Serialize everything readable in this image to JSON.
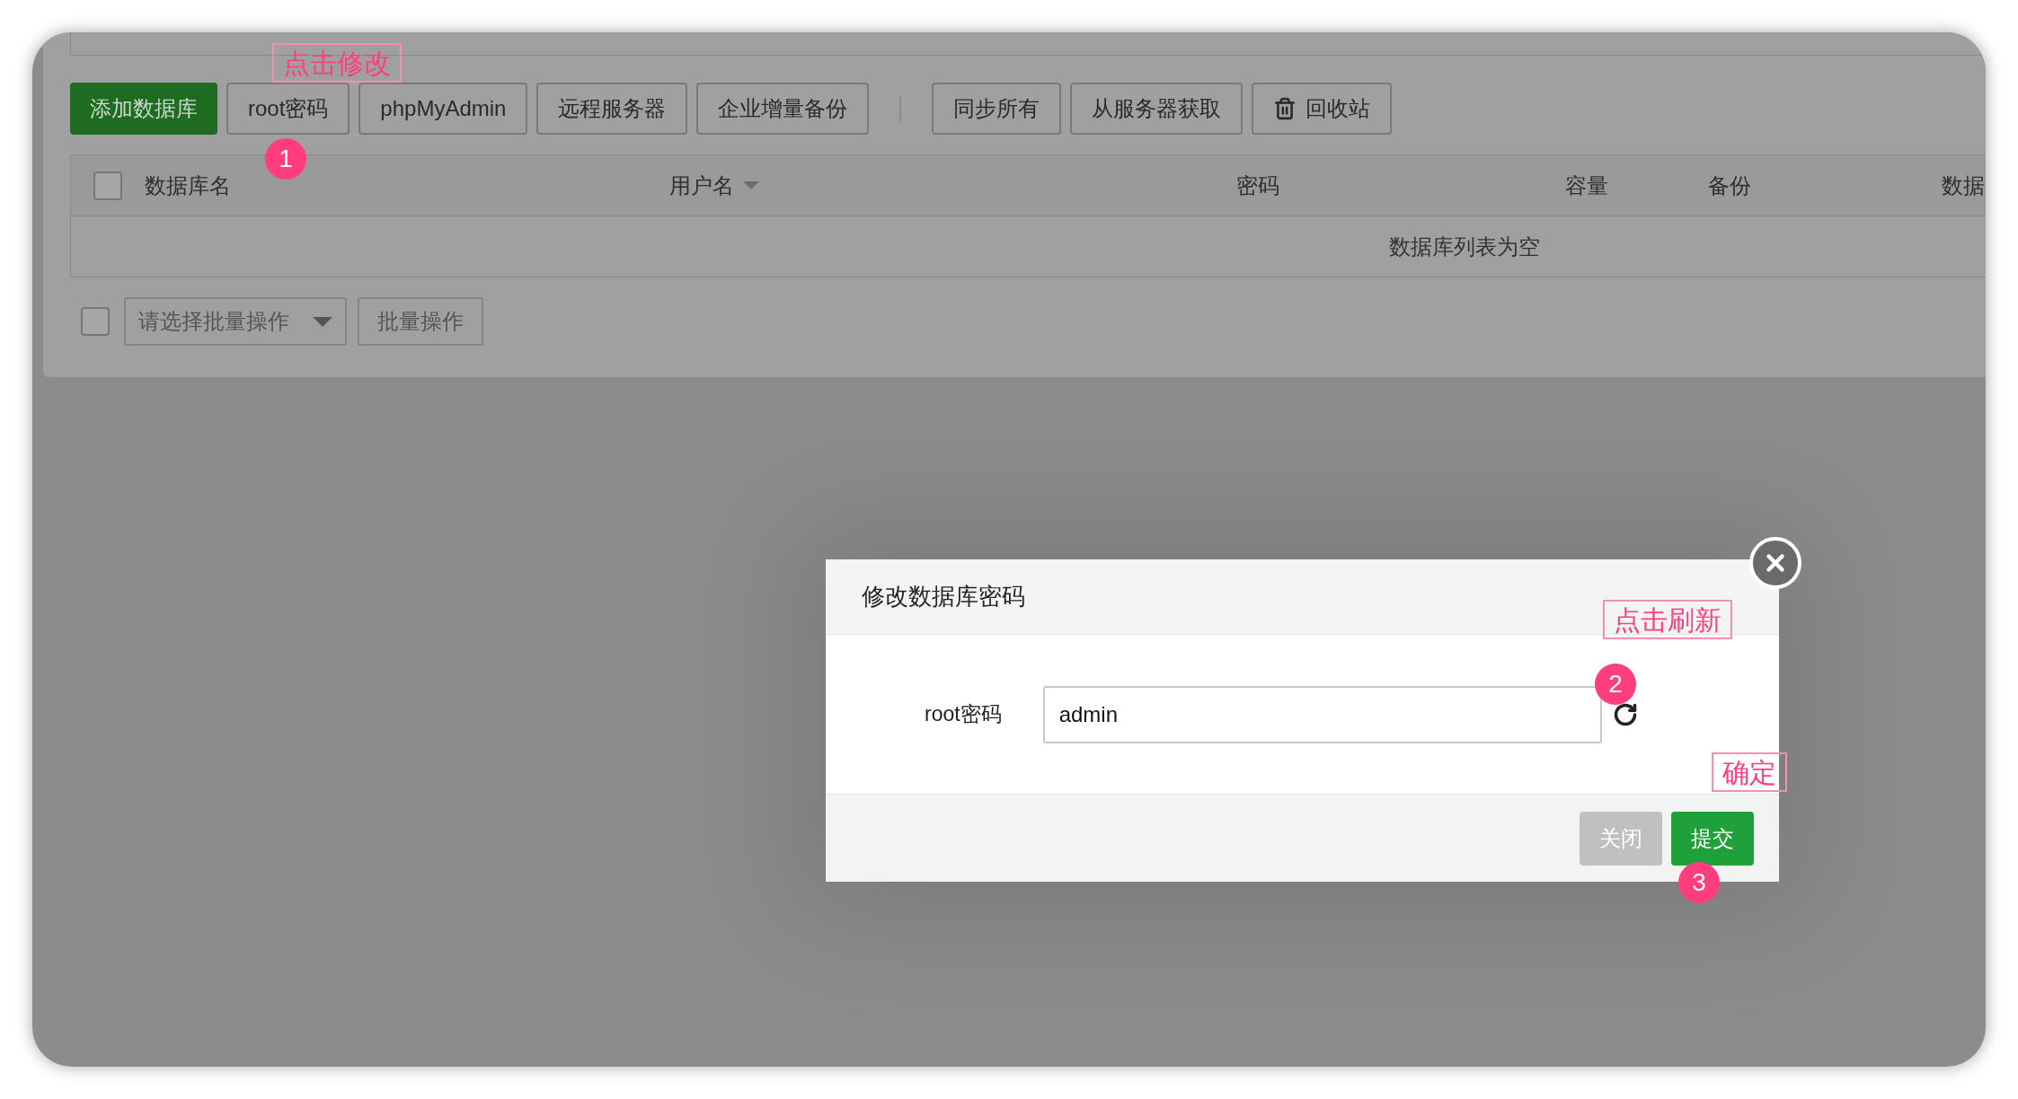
{
  "toolbar": [
    {
      "label": "添加数据库",
      "kind": "primary"
    },
    {
      "label": "root密码",
      "kind": "default"
    },
    {
      "label": "phpMyAdmin",
      "kind": "default"
    },
    {
      "label": "远程服务器",
      "kind": "default"
    },
    {
      "label": "企业增量备份",
      "kind": "default"
    },
    {
      "label": "同步所有",
      "kind": "default"
    },
    {
      "label": "从服务器获取",
      "kind": "default"
    },
    {
      "label": "回收站",
      "kind": "trash"
    }
  ],
  "table": {
    "select_all": {
      "checked": false
    },
    "columns": [
      {
        "label": "数据库名"
      },
      {
        "label": "用户名",
        "sortable": true
      },
      {
        "label": "密码"
      },
      {
        "label": "容量"
      },
      {
        "label": "备份"
      },
      {
        "label": "数据"
      }
    ],
    "empty_message": "数据库列表为空"
  },
  "batch": {
    "checked": false,
    "select_placeholder": "请选择批量操作",
    "button": "批量操作"
  },
  "dialog": {
    "title": "修改数据库密码",
    "field_label": "root密码",
    "field_value": "admin",
    "buttons": [
      {
        "label": "关闭",
        "kind": "secondary"
      },
      {
        "label": "提交",
        "kind": "primary"
      }
    ]
  },
  "annotations": [
    {
      "kind": "label",
      "text": "点击修改"
    },
    {
      "kind": "step",
      "text": "1"
    },
    {
      "kind": "label",
      "text": "点击刷新"
    },
    {
      "kind": "step",
      "text": "2"
    },
    {
      "kind": "label",
      "text": "确定"
    },
    {
      "kind": "step",
      "text": "3"
    }
  ]
}
